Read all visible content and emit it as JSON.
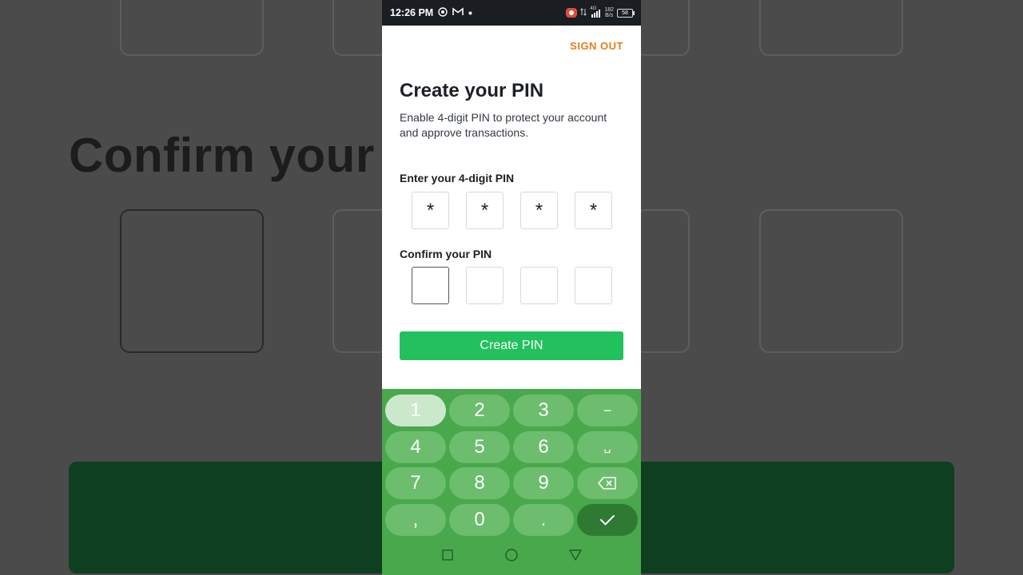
{
  "status_bar": {
    "time": "12:26 PM",
    "net_speed_value": "182",
    "net_speed_unit": "B/s",
    "network_type": "4G",
    "battery": "58"
  },
  "header": {
    "sign_out_label": "SIGN OUT"
  },
  "main": {
    "title": "Create your PIN",
    "subtitle": "Enable 4-digit PIN to protect your account and approve transactions.",
    "enter_label": "Enter your 4-digit PIN",
    "enter_pin": [
      "*",
      "*",
      "*",
      "*"
    ],
    "confirm_label": "Confirm your PIN",
    "confirm_pin": [
      "",
      "",
      "",
      ""
    ],
    "create_button_label": "Create PIN"
  },
  "keyboard": {
    "keys": [
      "1",
      "2",
      "3",
      "−",
      "4",
      "5",
      "6",
      "␣",
      "7",
      "8",
      "9",
      "backspace",
      ",",
      "0",
      ".",
      "done"
    ],
    "pressed_key": "1"
  },
  "background": {
    "title_text": "Confirm your PIN"
  },
  "colors": {
    "accent_orange": "#e67e17",
    "button_green": "#23c15e",
    "keyboard_green": "#4aa84c"
  }
}
